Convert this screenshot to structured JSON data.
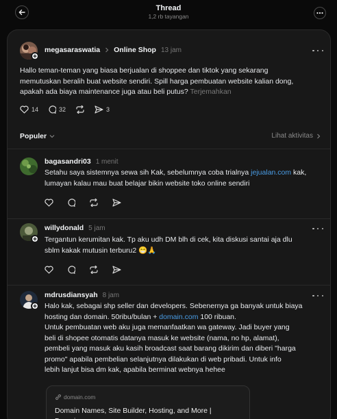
{
  "header": {
    "title": "Thread",
    "subtitle": "1,2 rb tayangan"
  },
  "main_post": {
    "author": "megasaraswatia",
    "community": "Online Shop",
    "time": "13 jam",
    "text_lines": [
      "Hallo teman-teman yang biasa berjualan di shoppee dan tiktok yang sekarang",
      "memutuskan beralih buat website sendiri. Spill harga pembuatan website kalian dong,",
      "apakah ada biaya maintenance juga atau beli putus?"
    ],
    "translate_label": "Terjemahkan",
    "likes": "14",
    "replies": "32",
    "shares": "3"
  },
  "sort": {
    "label": "Populer",
    "activity_link": "Lihat aktivitas"
  },
  "replies": [
    {
      "author": "bagasandri03",
      "time": "1 menit",
      "line1_before": "Setahu saya sistemnya sewa sih Kak, sebelumnya coba trialnya ",
      "line1_link": "jejualan.com",
      "line1_after": " kak,",
      "line2": "lumayan kalau mau buat belajar bikin website toko online sendiri"
    },
    {
      "author": "willydonald",
      "time": "5 jam",
      "line1": "Tergantun kerumitan kak. Tp aku udh DM blh di cek, kita diskusi santai aja dlu",
      "line2": "sblm kakak mutusin terburu2 😁🙏"
    },
    {
      "author": "mdrusdiansyah",
      "time": "8 jam",
      "line1": "Halo kak, sebagai shp seller dan developers. Sebenernya ga banyak untuk biaya",
      "line2_before": "hosting dan domain. 50ribu/bulan + ",
      "line2_link": "domain.com",
      "line2_after": " 100 ribuan.",
      "line3": "Untuk pembuatan web aku juga memanfaatkan wa gateway. Jadi buyer yang",
      "line4": "beli di shopee otomatis datanya masuk ke website (nama, no hp, alamat),",
      "line5": "pembeli yang masuk aku kasih broadcast saat barang dikirim dan diberi \"harga",
      "line6": "promo\" apabila pembelian selanjutnya dilakukan di web pribadi. Untuk info",
      "line7": "lebih lanjut bisa dm kak, apabila berminat webnya hehee",
      "preview": {
        "domain": "domain.com",
        "title": "Domain Names, Site Builder, Hosting, and More | Domain..."
      }
    }
  ],
  "colors": {
    "background": "#0a0a0a",
    "card": "#181818",
    "link": "#4a9de6",
    "text": "#f3f5f7"
  }
}
